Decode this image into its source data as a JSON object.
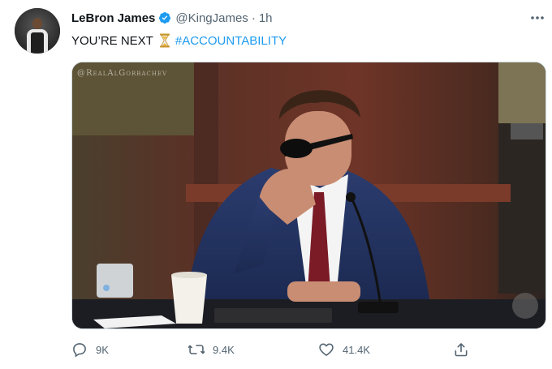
{
  "tweet": {
    "author_name": "LeBron James",
    "handle": "@KingJames",
    "separator": "·",
    "time": "1h",
    "text_prefix": "YOU’RE NEXT",
    "hashtag": "#ACCOUNTABILITY",
    "verified": true
  },
  "media": {
    "watermark": "@RealAlGorbachev"
  },
  "actions": {
    "reply_count": "9K",
    "retweet_count": "9.4K",
    "like_count": "41.4K"
  },
  "icons": {
    "verified": "verified-badge-icon",
    "more": "more-options-icon",
    "emoji": "hourglass-emoji-icon",
    "reply": "reply-icon",
    "retweet": "retweet-icon",
    "like": "heart-icon",
    "share": "share-icon"
  },
  "colors": {
    "accent": "#1d9bf0",
    "text": "#0f1419",
    "muted": "#536471"
  }
}
